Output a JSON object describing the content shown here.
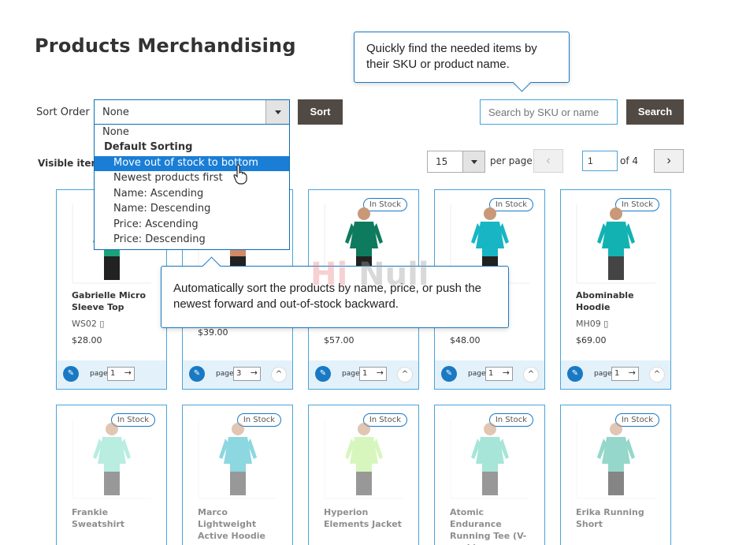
{
  "page": {
    "title": "Products Merchandising"
  },
  "sort": {
    "label": "Sort Order",
    "selected": "None",
    "button": "Sort",
    "options": [
      {
        "label": "None",
        "kind": "option"
      },
      {
        "label": "Default Sorting",
        "kind": "group"
      },
      {
        "label": "Move out of stock to bottom",
        "kind": "option",
        "highlighted": true
      },
      {
        "label": "Newest products first",
        "kind": "option"
      },
      {
        "label": "Name: Ascending",
        "kind": "option"
      },
      {
        "label": "Name: Descending",
        "kind": "option"
      },
      {
        "label": "Price: Ascending",
        "kind": "option"
      },
      {
        "label": "Price: Descending",
        "kind": "option"
      }
    ]
  },
  "search": {
    "placeholder": "Search by SKU or name",
    "button": "Search"
  },
  "toolbar": {
    "visible_label": "Visible item",
    "per_page_value": "15",
    "per_page_label": "per page",
    "prev_icon": "‹",
    "next_icon": "›",
    "current_page": "1",
    "of_label": "of 4"
  },
  "tooltips": {
    "search_tip": "Quickly find the needed items by their SKU or product name.",
    "sort_tip": "Automatically sort the products by name, price, or push the newest forward and out-of-stock backward."
  },
  "watermark": {
    "a": "Hi",
    "b": "Null"
  },
  "products_row1": [
    {
      "name": "Gabrielle Micro Sleeve Top",
      "sku": "WS02",
      "price": "$28.00",
      "badge": "",
      "page": "1",
      "color": "#1aa37a",
      "kind": "woman"
    },
    {
      "name": "",
      "sku": "",
      "price": "$39.00",
      "badge": "",
      "page": "3",
      "color": "#d08a6a",
      "kind": "woman"
    },
    {
      "name": "",
      "sku": "",
      "price": "$57.00",
      "badge": "In Stock",
      "page": "1",
      "color": "#0e7b5e",
      "kind": "woman"
    },
    {
      "name": "",
      "sku": "",
      "price": "$48.00",
      "badge": "In Stock",
      "page": "1",
      "color": "#18b6c4",
      "kind": "woman"
    },
    {
      "name": "Abominable Hoodie",
      "sku": "MH09",
      "price": "$69.00",
      "badge": "In Stock",
      "page": "1",
      "color": "#13b2b2",
      "kind": "man"
    }
  ],
  "products_row2": [
    {
      "name": "Frankie Sweatshirt",
      "badge": "In Stock",
      "color": "#7fe0c8",
      "kind": "man"
    },
    {
      "name": "Marco Lightweight Active Hoodie",
      "badge": "In Stock",
      "color": "#2fb8c8",
      "kind": "man"
    },
    {
      "name": "Hyperion Elements Jacket",
      "badge": "In Stock",
      "color": "#b8f08a",
      "kind": "man"
    },
    {
      "name": "Atomic Endurance Running Tee (V-neck)",
      "badge": "In Stock",
      "color": "#5fd0b8",
      "kind": "man"
    },
    {
      "name": "Erika Running Short",
      "badge": "In Stock",
      "color": "#3fb8a0",
      "kind": "woman"
    }
  ],
  "card_footer": {
    "page_label": "page",
    "go_icon": "→",
    "pin_icon": "✎",
    "up_icon": "^"
  }
}
